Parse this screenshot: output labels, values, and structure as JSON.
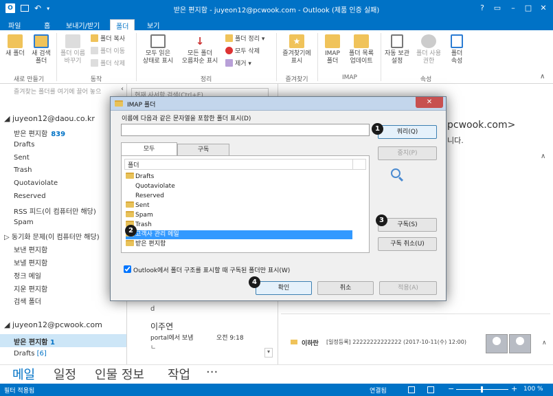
{
  "window": {
    "title": "받은 편지함 - juyeon12@pcwook.com - Outlook (제품 인증 실패)",
    "help": "?",
    "restore": "▭",
    "minimize": "–",
    "maximize": "□",
    "close": "✕"
  },
  "tabs": [
    "파일",
    "홈",
    "보내기/받기",
    "폴더",
    "보기"
  ],
  "ribbon": {
    "new_group": {
      "label": "새로 만들기",
      "new_folder": "새 폴더",
      "new_search": "새 검색\n폴더"
    },
    "actions_group": {
      "label": "동작",
      "rename": "폴더 이름\n바꾸기",
      "copy": "폴더 복사",
      "move": "폴더 이동",
      "delete": "폴더 삭제"
    },
    "cleanup_group": {
      "label": "정리",
      "mark_all_read": "모두 읽은\n상태로 표시",
      "sort_all": "모든 폴더\n오름차순 표시",
      "cleanup": "폴더 정리 ▾",
      "delete_all": "모두 삭제",
      "remove": "제거 ▾"
    },
    "fav_group": {
      "label": "즐겨찾기",
      "show_in_fav": "즐겨찾기에\n표시"
    },
    "imap_group": {
      "label": "IMAP",
      "imap_folder": "IMAP\n폴더",
      "update_list": "폴더 목록\n업데이트"
    },
    "props_group": {
      "label": "속성",
      "autoarchive": "자동 보관\n설정",
      "permissions": "폴더 사용\n권한",
      "properties": "폴더\n속성"
    }
  },
  "left": {
    "fav_hint": "즐겨찾는 폴더를 여기에 끌어 놓으",
    "account1": "◢ juyeon12@daou.co.kr",
    "folders1": [
      {
        "name": "받은 편지함",
        "count": "839"
      },
      {
        "name": "Drafts"
      },
      {
        "name": "Sent"
      },
      {
        "name": "Trash"
      },
      {
        "name": "Quotaviolate"
      },
      {
        "name": "Reserved"
      },
      {
        "name": "RSS 피드(이 컴퓨터만 해당)"
      },
      {
        "name": "Spam"
      },
      {
        "name": "▷ 동기화 문제(이 컴퓨터만 해당)"
      },
      {
        "name": "보낸 편지함"
      },
      {
        "name": "보낼 편지함"
      },
      {
        "name": "정크 메일"
      },
      {
        "name": "지운 편지함"
      },
      {
        "name": "검색 폴더"
      }
    ],
    "account2": "◢ juyeon12@pcwook.com",
    "folders2": [
      {
        "name": "받은 편지함",
        "count": "1"
      },
      {
        "name": "Drafts",
        "count": "[6]"
      }
    ]
  },
  "middle": {
    "search_placeholder": "현재 사서함 검색(Ctrl+E)",
    "fragment_d": "d",
    "mail_sender": "이주연",
    "mail_subject": "portal에서 보냄",
    "mail_time": "오전 9:18",
    "mail_preview": "ㄴ"
  },
  "reading": {
    "addr_fragment": "pcwook.com>",
    "line2_fragment": "니다.",
    "footer_sender": "이하란",
    "footer_subject": "[일정등록] 22222222222222 (2017-10-11(수) 12:00)"
  },
  "nav": [
    "메일",
    "일정",
    "인물 정보",
    "작업",
    "···"
  ],
  "status": {
    "left": "필터 적용됨",
    "connected": "연결됨",
    "zoom": "100 %",
    "minus": "−",
    "plus": "+"
  },
  "dialog": {
    "title": "IMAP 폴더",
    "close": "✕",
    "filter_label": "이름에 다음과 같은 문자열을 포함한 폴더 표시(D)",
    "filter_value": "",
    "tab_all": "모두",
    "tab_subscribed": "구독",
    "column_header": "폴더",
    "tree": [
      {
        "name": "Drafts",
        "level": 0,
        "folder": true
      },
      {
        "name": "Quotaviolate",
        "level": 1,
        "folder": false
      },
      {
        "name": "Reserved",
        "level": 1,
        "folder": false
      },
      {
        "name": "Sent",
        "level": 0,
        "folder": true
      },
      {
        "name": "Spam",
        "level": 0,
        "folder": true
      },
      {
        "name": "Trash",
        "level": 0,
        "folder": true
      },
      {
        "name": "고객사 관리 메일",
        "level": 0,
        "folder": true,
        "selected": true
      },
      {
        "name": "받은 편지함",
        "level": 0,
        "folder": true
      }
    ],
    "btn_query": "쿼리(Q)",
    "btn_stop": "중지(P)",
    "btn_subscribe": "구독(S)",
    "btn_unsubscribe": "구독 취소(U)",
    "checkbox_label": "Outlook에서 폴더 구조를 표시할 때 구독된 폴더만 표시(W)",
    "checkbox_checked": true,
    "btn_ok": "확인",
    "btn_cancel": "취소",
    "btn_apply": "적용(A)",
    "badges": [
      "1",
      "2",
      "3",
      "4"
    ]
  },
  "colors": {
    "brand": "#0072c6",
    "selection": "#3399ff",
    "folder": "#e8c25a"
  }
}
